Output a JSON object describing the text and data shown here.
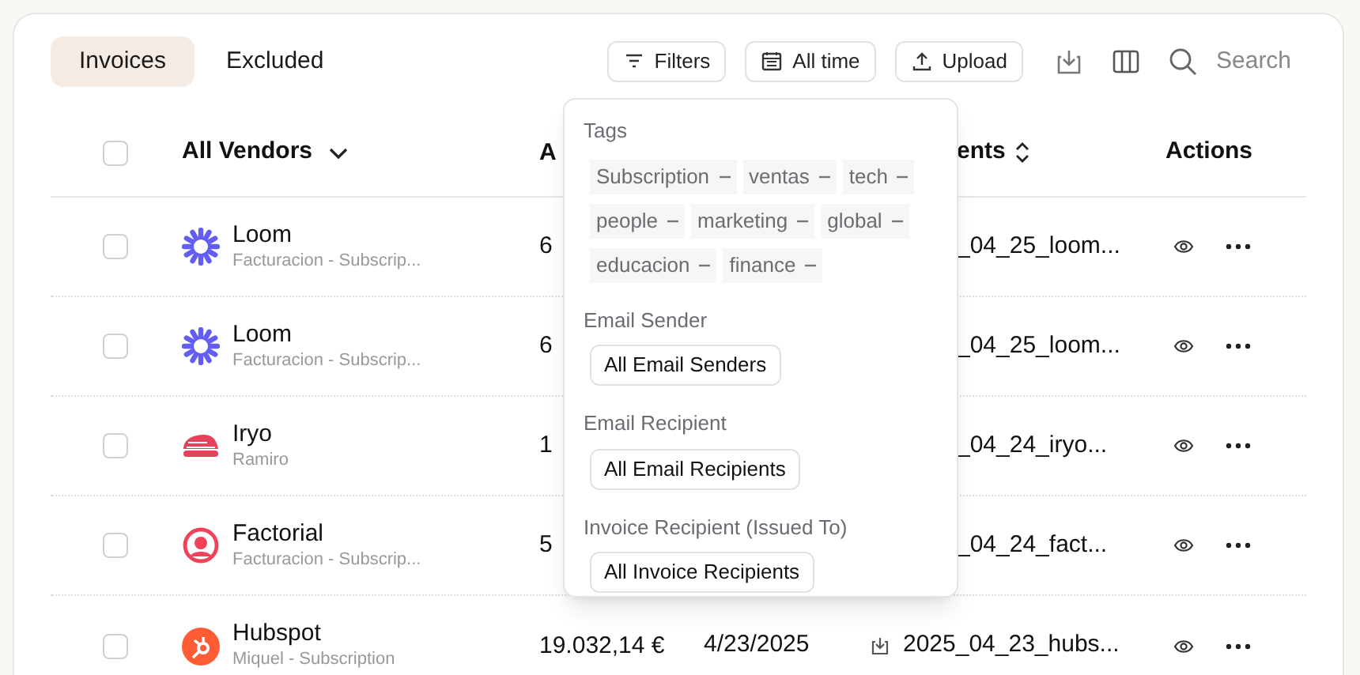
{
  "tabs": [
    {
      "label": "Invoices",
      "selected": true
    },
    {
      "label": "Excluded",
      "selected": false
    }
  ],
  "toolbar": {
    "buttons": [
      {
        "kind": "filter",
        "label": "Filters"
      },
      {
        "kind": "calendar",
        "label": "All time"
      },
      {
        "kind": "upload",
        "label": "Upload"
      }
    ],
    "search": {
      "placeholder": "Search"
    }
  },
  "table": {
    "select_all": {
      "checked": false
    },
    "columns": {
      "vendor": "All Vendors",
      "amount": "A",
      "documents": "ents",
      "actions": "Actions"
    },
    "rows": [
      {
        "checked": false,
        "kind": "loom",
        "vendor": "Loom",
        "subtitle": "Facturacion - Subscrip...",
        "amount": "6",
        "document": "_04_25_loom...",
        "document_icon": false
      },
      {
        "checked": false,
        "kind": "loom",
        "vendor": "Loom",
        "subtitle": "Facturacion - Subscrip...",
        "amount": "6",
        "document": "_04_25_loom...",
        "document_icon": false
      },
      {
        "checked": false,
        "kind": "iryo",
        "vendor": "Iryo",
        "subtitle": "Ramiro",
        "amount": "1",
        "document": "_04_24_iryo...",
        "document_icon": false
      },
      {
        "checked": false,
        "kind": "factorial",
        "vendor": "Factorial",
        "subtitle": "Facturacion - Subscrip...",
        "amount": "5",
        "document": "_04_24_fact...",
        "document_icon": false
      },
      {
        "checked": false,
        "kind": "hubspot",
        "vendor": "Hubspot",
        "subtitle": "Miquel - Subscription",
        "amount": "19.032,14 €",
        "date": "4/23/2025",
        "document": "2025_04_23_hubs...",
        "document_icon": true
      }
    ]
  },
  "filters_menu": {
    "tags_title": "Tags",
    "tags": [
      {
        "label": "Subscription"
      },
      {
        "label": "ventas"
      },
      {
        "label": "tech"
      },
      {
        "label": "people"
      },
      {
        "label": "marketing"
      },
      {
        "label": "global"
      },
      {
        "label": "educacion"
      },
      {
        "label": "finance"
      }
    ],
    "sections": [
      {
        "title": "Email Sender",
        "button": "All Email Senders"
      },
      {
        "title": "Email Recipient",
        "button": "All Email Recipients"
      },
      {
        "title": "Invoice Recipient (Issued To)",
        "button": "All Invoice Recipients"
      }
    ]
  }
}
